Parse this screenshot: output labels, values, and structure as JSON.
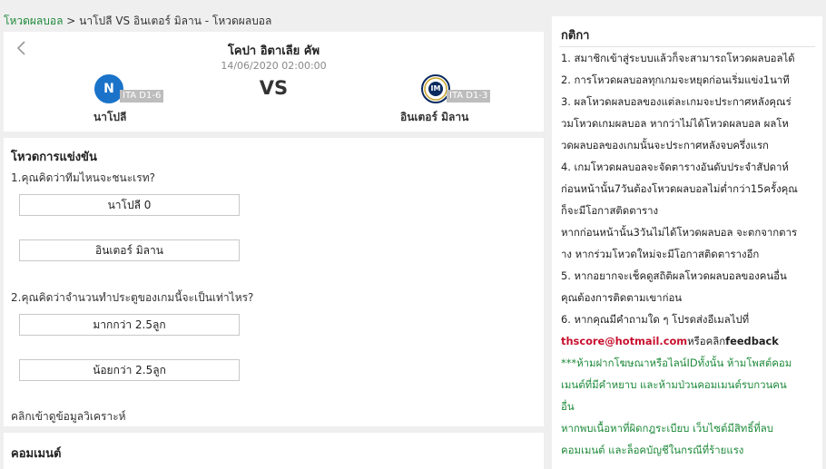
{
  "breadcrumb": {
    "home": "โหวดผลบอล",
    "separator": ">",
    "current": "นาโปลี VS อินเตอร์ มิลาน - โหวดผลบอล"
  },
  "match": {
    "league": "โคปา อิตาเลีย คัพ",
    "datetime": "14/06/2020 02:00:00",
    "vs": "VS",
    "home": {
      "name": "นาโปลี",
      "rank": "ITA D1-6",
      "logo_letter": "N"
    },
    "away": {
      "name": "อินเตอร์ มิลาน",
      "rank": "ITA D1-3",
      "logo_letter": "IM"
    }
  },
  "vote": {
    "title": "โหวดการแข่งขัน",
    "q1": {
      "text": "1.คุณคิดว่าทีมไหนจะชนะเรท?",
      "options": [
        "นาโปลี 0",
        "อินเตอร์ มิลาน"
      ]
    },
    "q2": {
      "text": "2.คุณคิดว่าจำนวนทำประตูของเกมนี้จะเป็นเท่าไหร?",
      "options": [
        "มากกว่า 2.5ลูก",
        "น้อยกว่า 2.5ลูก"
      ]
    },
    "analysis_link": "คลิกเข้าดูข้อมูลวิเคราะห์"
  },
  "comment": {
    "title": "คอมเมนต์"
  },
  "rules": {
    "title": "กติกา",
    "lines": [
      "1. สมาชิกเข้าสู่ระบบแล้วก็จะสามารถโหวดผลบอลได้",
      "2. การโหวดผลบอลทุกเกมจะหยุดก่อนเริ่มแข่ง1นาที",
      "3. ผลโหวดผลบอลของแต่ละเกมจะประกาศหลังคุณร่",
      "วมโหวดเกมผลบอล หากว่าไม่ได้โหวดผลบอล ผลโห",
      "วดผลบอลของเกมนั้นจะประกาศหลังจบครึ่งแรก",
      "4. เกมโหวดผลบอลจะจัดตารางอันดับประจำสัปดาห์",
      "ก่อนหน้านั้น7วันต้องโหวดผลบอลไม่ต่ำกว่า15ครั้งคุณ",
      "ก็จะมีโอกาสติดตาราง",
      "หากก่อนหน้านั้น3วันไม่ได้โหวดผลบอล จะตกจากตาร",
      "าง หากร่วมโหวดใหม่จะมีโอกาสติดตารางอีก",
      "5. หากอยากจะเช็คดูสถิติผลโหวดผลบอลของคนอื่น",
      "คุณต้องการติดตามเขาก่อน",
      "6. หากคุณมีคำถามใด ๆ โปรดส่งอีเมลไปที่"
    ],
    "email": "thscore@hotmail.com",
    "email_suffix": "หรือคลิก",
    "feedback": "feedback",
    "warnings": [
      "***ห้ามฝากโฆษณาหรือไลน์IDทั้งนั้น ห้ามโพสต์คอม",
      "เมนต์ที่มีคำหยาบ  และห้ามป่วนคอมเมนต์รบกวนคน",
      "อื่น",
      "หากพบเนื้อหาที่ผิดกฎระเบียบ เว็บไซต์มีสิทธิ์ที่ลบ",
      "คอมเมนต์ และล็อคบัญชีในกรณีที่ร้ายแรง"
    ]
  },
  "colors": {
    "accent": "#1e8a3a",
    "email": "#c8102e",
    "napoli": "#1a73c9",
    "inter": "#0a2a5e"
  },
  "icons": {
    "back": "chevron-left-icon"
  }
}
